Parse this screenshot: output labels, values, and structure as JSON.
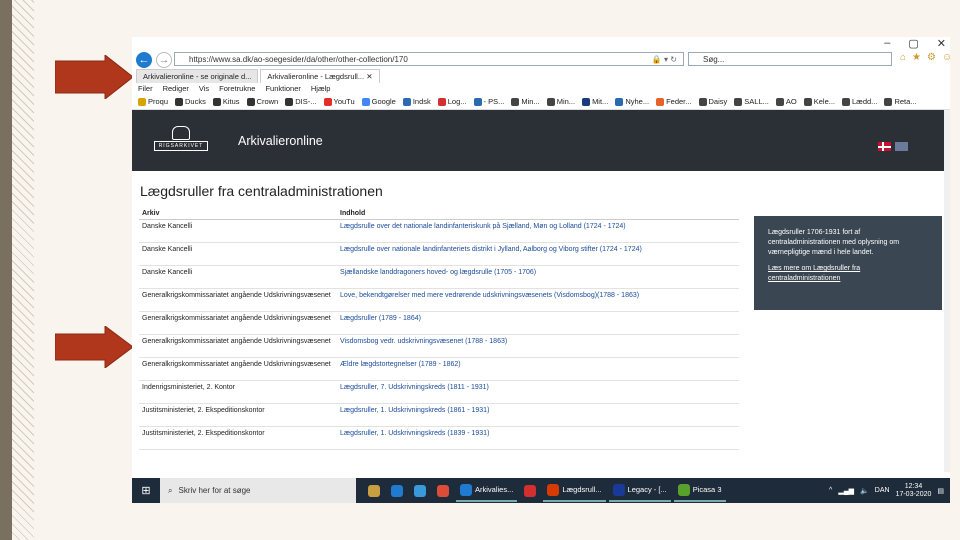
{
  "browser": {
    "window_controls": [
      "–",
      "▢",
      "✕"
    ],
    "url": "https://www.sa.dk/ao-soegesider/da/other/other-collection/170",
    "search_placeholder": "Søg...",
    "tabs": [
      {
        "label": "Arkivalieronline - se originale d..."
      },
      {
        "label": "Arkivalieronline - Lægdsrull..."
      }
    ],
    "tab_close": "✕",
    "menu": [
      "Filer",
      "Rediger",
      "Vis",
      "Foretrukne",
      "Funktioner",
      "Hjælp"
    ],
    "favorites": [
      {
        "label": "Proqu",
        "color": "#d9a400"
      },
      {
        "label": "Ducks",
        "color": "#333"
      },
      {
        "label": "Kitus",
        "color": "#333"
      },
      {
        "label": "Crown",
        "color": "#333"
      },
      {
        "label": "DIS-...",
        "color": "#333"
      },
      {
        "label": "YouTu",
        "color": "#e52d27"
      },
      {
        "label": "Google",
        "color": "#4285f4"
      },
      {
        "label": "Indsk",
        "color": "#2a6ab0"
      },
      {
        "label": "Log...",
        "color": "#d32f2f"
      },
      {
        "label": "- PS...",
        "color": "#2a6ab0"
      },
      {
        "label": "Min...",
        "color": "#444"
      },
      {
        "label": "Min...",
        "color": "#444"
      },
      {
        "label": "Mit...",
        "color": "#1a3a7a"
      },
      {
        "label": "Nyhe...",
        "color": "#2a6ab0"
      },
      {
        "label": "Feder...",
        "color": "#e5632a"
      },
      {
        "label": "Daisy",
        "color": "#444"
      },
      {
        "label": "SALL...",
        "color": "#444"
      },
      {
        "label": "AO",
        "color": "#444"
      },
      {
        "label": "Kele...",
        "color": "#444"
      },
      {
        "label": "Lædd...",
        "color": "#444"
      },
      {
        "label": "Reta...",
        "color": "#444"
      }
    ]
  },
  "site": {
    "logo_text": "RIGSARKIVET",
    "name": "Arkivalieronline",
    "page_title": "Lægdsruller fra centraladministrationen",
    "columns": [
      "Arkiv",
      "Indhold"
    ],
    "rows": [
      {
        "arkiv": "Danske Kancelli",
        "indhold": "Lægdsrulle over det nationale landinfanteriskunk på Sjælland, Møn og Lolland (1724 - 1724)"
      },
      {
        "arkiv": "Danske Kancelli",
        "indhold": "Lægdsrulle over nationale landinfanteriets distrikt i Jylland, Aalborg og Viborg stifter (1724 - 1724)"
      },
      {
        "arkiv": "Danske Kancelli",
        "indhold": "Sjællandske landdragoners hoved- og lægdsrulle (1705 - 1706)"
      },
      {
        "arkiv": "Generalkrigskommissariatet angående Udskrivningsvæsenet",
        "indhold": "Love, bekendtgørelser med mere vedrørende udskrivningsvæsenets (Visdomsbog)(1788 - 1863)"
      },
      {
        "arkiv": "Generalkrigskommissariatet angående Udskrivningsvæsenet",
        "indhold": "Lægdsruller (1789 - 1864)"
      },
      {
        "arkiv": "Generalkrigskommissariatet angående Udskrivningsvæsenet",
        "indhold": "Visdomsbog vedr. udskrivningsvæsenet (1788 - 1863)"
      },
      {
        "arkiv": "Generalkrigskommissariatet angående Udskrivningsvæsenet",
        "indhold": "Ældre lægdstortegnelser (1789 - 1862)"
      },
      {
        "arkiv": "Indenrigsministeriet, 2. Kontor",
        "indhold": "Lægdsruller, 7. Udskrivningskreds (1811 - 1931)"
      },
      {
        "arkiv": "Justitsministeriet, 2. Ekspeditionskontor",
        "indhold": "Lægdsruller, 1. Udskrivningskreds (1861 - 1931)"
      },
      {
        "arkiv": "Justitsministeriet, 2. Ekspeditionskontor",
        "indhold": "Lægdsruller, 1. Udskrivningskreds (1839 - 1931)"
      }
    ],
    "sidebox": {
      "text": "Lægdsruller 1706-1931 fort af centraladministrationen med oplysning om værnepligtige mænd i hele landet.",
      "link": "Læs mere om Lægdsruller fra centraladministrationen"
    }
  },
  "taskbar": {
    "search": "Skriv her for at søge",
    "apps": [
      {
        "label": "",
        "color": "#c8a040"
      },
      {
        "label": "",
        "color": "#1f7ad0"
      },
      {
        "label": "",
        "color": "#3a9ad9"
      },
      {
        "label": "",
        "color": "#dd4b39"
      },
      {
        "label": "Arkivalies...",
        "color": "#1f7ad0"
      },
      {
        "label": "",
        "color": "#d32f2f"
      },
      {
        "label": "Lægdsrull...",
        "color": "#d83b01"
      },
      {
        "label": "Legacy - [...",
        "color": "#1a3a9a"
      },
      {
        "label": "Picasa 3",
        "color": "#5aa02c"
      }
    ],
    "lang": "DAN",
    "time": "12:34",
    "date": "17-03-2020"
  }
}
